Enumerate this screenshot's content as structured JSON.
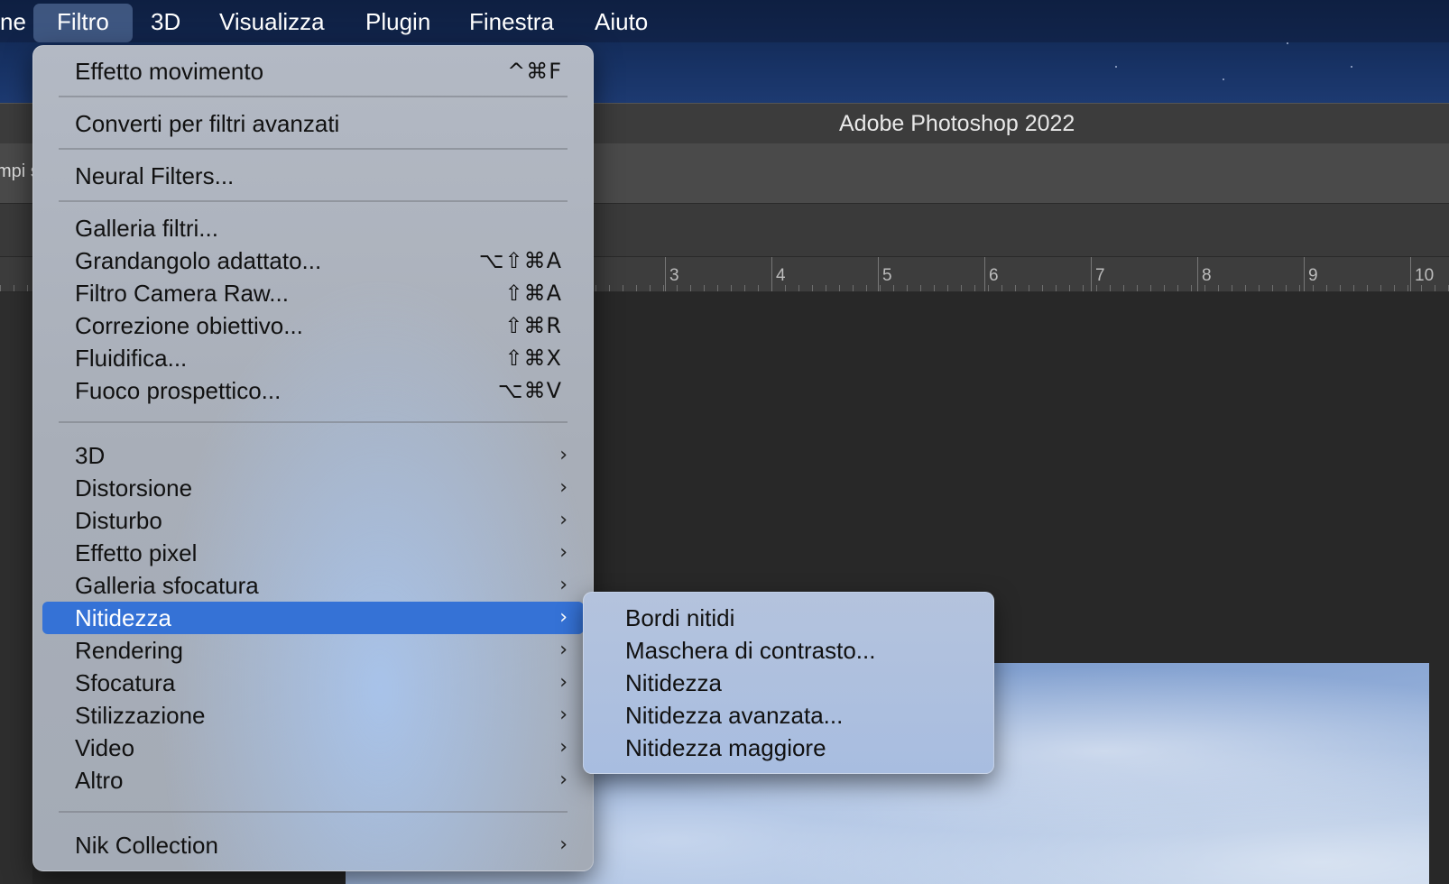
{
  "menubar": {
    "items": [
      {
        "label": "ne"
      },
      {
        "label": "Filtro"
      },
      {
        "label": "3D"
      },
      {
        "label": "Visualizza"
      },
      {
        "label": "Plugin"
      },
      {
        "label": "Finestra"
      },
      {
        "label": "Aiuto"
      }
    ]
  },
  "window": {
    "title": "Adobe Photoshop 2022",
    "options_partial_text": "mpi s"
  },
  "ruler": {
    "labels": [
      "3",
      "4",
      "5",
      "6",
      "7",
      "8",
      "9",
      "10"
    ]
  },
  "filter_menu": {
    "items": [
      {
        "label": "Effetto movimento",
        "shortcut": "^⌘F"
      },
      {
        "label": "Converti per filtri avanzati",
        "shortcut": ""
      },
      {
        "label": "Neural Filters...",
        "shortcut": ""
      },
      {
        "label": "Galleria filtri...",
        "shortcut": ""
      },
      {
        "label": "Grandangolo adattato...",
        "shortcut": "⌥⇧⌘A"
      },
      {
        "label": "Filtro Camera Raw...",
        "shortcut": "⇧⌘A"
      },
      {
        "label": "Correzione obiettivo...",
        "shortcut": "⇧⌘R"
      },
      {
        "label": "Fluidifica...",
        "shortcut": "⇧⌘X"
      },
      {
        "label": "Fuoco prospettico...",
        "shortcut": "⌥⌘V"
      },
      {
        "label": "3D",
        "submenu": "›"
      },
      {
        "label": "Distorsione",
        "submenu": "›"
      },
      {
        "label": "Disturbo",
        "submenu": "›"
      },
      {
        "label": "Effetto pixel",
        "submenu": "›"
      },
      {
        "label": "Galleria sfocatura",
        "submenu": "›"
      },
      {
        "label": "Nitidezza",
        "submenu": "›"
      },
      {
        "label": "Rendering",
        "submenu": "›"
      },
      {
        "label": "Sfocatura",
        "submenu": "›"
      },
      {
        "label": "Stilizzazione",
        "submenu": "›"
      },
      {
        "label": "Video",
        "submenu": "›"
      },
      {
        "label": "Altro",
        "submenu": "›"
      },
      {
        "label": "Nik Collection",
        "submenu": "›"
      }
    ],
    "highlighted": "Nitidezza"
  },
  "sharpen_submenu": {
    "items": [
      {
        "label": "Bordi nitidi"
      },
      {
        "label": "Maschera di contrasto..."
      },
      {
        "label": "Nitidezza"
      },
      {
        "label": "Nitidezza avanzata..."
      },
      {
        "label": "Nitidezza maggiore"
      }
    ]
  },
  "colors": {
    "highlight": "#3572d6",
    "menu_bg": "#aab0ba",
    "ps_dark": "#282828"
  }
}
